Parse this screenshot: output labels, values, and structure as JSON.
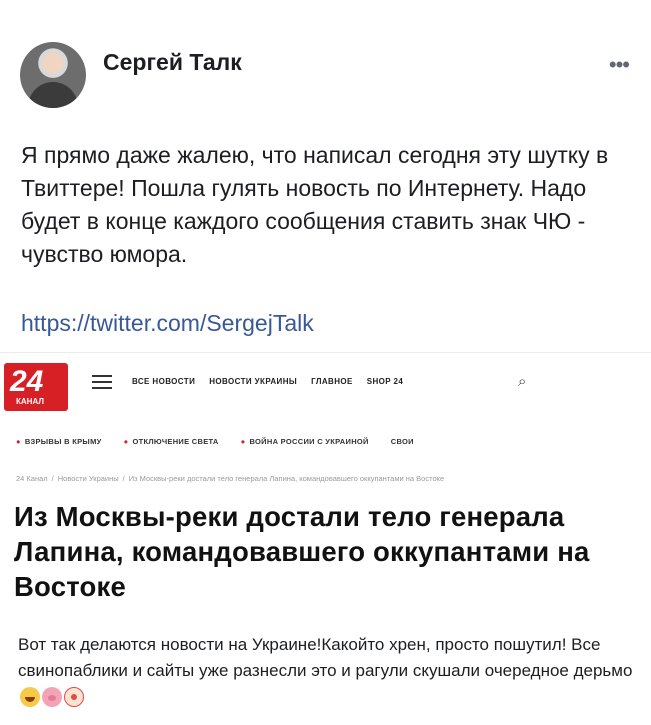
{
  "post": {
    "author": "Сергей Талк",
    "more": "•••",
    "text": "Я прямо даже жалею, что написал сегодня эту шутку в Твиттере! Пошла гулять новость по Интернету. Надо будет в конце каждого сообщения ставить знак ЧЮ - чувство юмора.",
    "link": "https://twitter.com/SergejTalk"
  },
  "news": {
    "logo_number": "24",
    "logo_sub": "КАНАЛ",
    "nav": [
      "ВСЕ НОВОСТИ",
      "НОВОСТИ УКРАИНЫ",
      "ГЛАВНОЕ",
      "SHOP 24"
    ],
    "tags": [
      "ВЗРЫВЫ В КРЫМУ",
      "ОТКЛЮЧЕНИЕ СВЕТА",
      "ВОЙНА РОССИИ С УКРАИНОЙ",
      "СВОИ"
    ],
    "breadcrumb": [
      "24 Канал",
      "Новости Украины",
      "Из Москвы-реки достали тело генерала Лапина, командовавшего оккупантами на Востоке"
    ],
    "headline": "Из Москвы-реки достали тело генерала Лапина, командовавшего оккупантами на Востоке"
  },
  "caption": {
    "text": "Вот так делаются новости на Украине!Какойто хрен, просто пошутил! Все свинопаблики и сайты уже разнесли это и рагули скушали очередное дерьмо",
    "emojis": [
      "laughing-emoji",
      "pig-emoji",
      "clown-emoji"
    ]
  },
  "colors": {
    "brand_red": "#d71f26",
    "link": "#385898"
  }
}
